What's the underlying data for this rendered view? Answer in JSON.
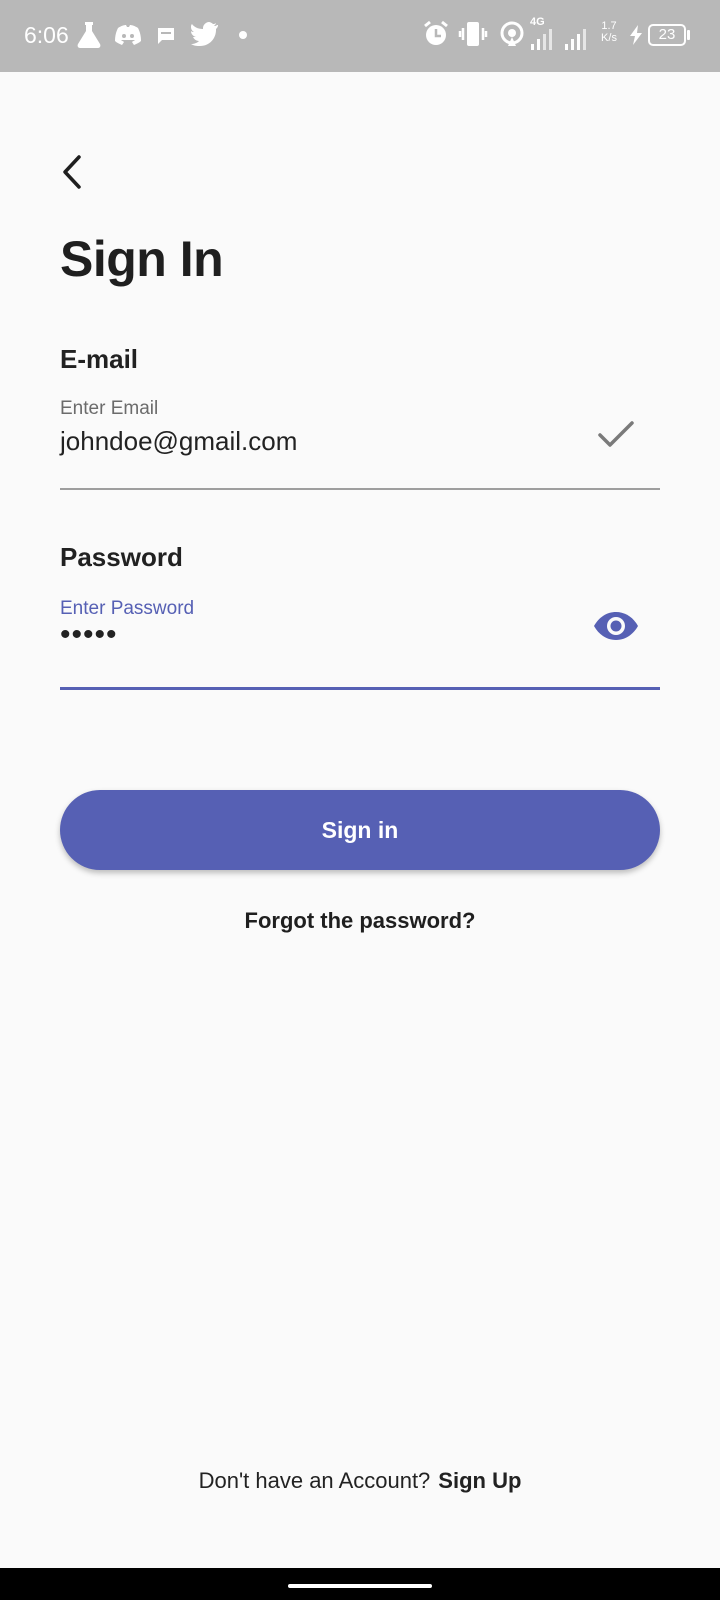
{
  "status_bar": {
    "time": "6:06",
    "network_type": "4G",
    "speed_value": "1.7",
    "speed_unit": "K/s",
    "battery": "23",
    "left_icons": [
      "flask-icon",
      "discord-icon",
      "message-icon",
      "twitter-icon",
      "dot-icon"
    ],
    "right_icons": [
      "alarm-icon",
      "vibrate-icon",
      "hotspot-icon",
      "signal-icon",
      "signal-icon",
      "charging-icon",
      "battery-icon"
    ]
  },
  "header": {
    "back_icon": "chevron-left-icon",
    "title": "Sign In"
  },
  "form": {
    "email": {
      "heading": "E-mail",
      "floating_label": "Enter Email",
      "value": "johndoe@gmail.com",
      "status_icon": "check-icon"
    },
    "password": {
      "heading": "Password",
      "floating_label": "Enter Password",
      "masked_value": "•••••",
      "toggle_icon": "eye-icon"
    },
    "submit_label": "Sign in",
    "forgot_label": "Forgot the password?"
  },
  "footer": {
    "prompt": "Don't have an Account?",
    "signup_label": "Sign Up"
  },
  "colors": {
    "accent": "#5660b4",
    "status_bar_bg": "#b8b8b8",
    "background": "#fafafa",
    "text": "#1f1f1f"
  }
}
